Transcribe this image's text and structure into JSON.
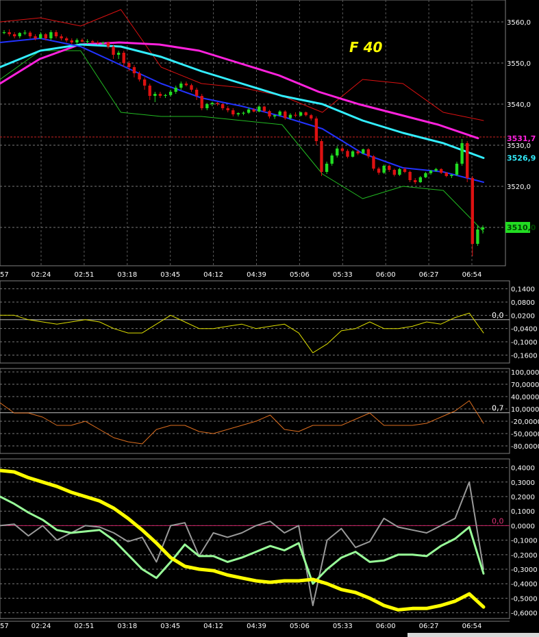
{
  "chart_data": {
    "type": "candlestick",
    "title": "F 40",
    "time_labels": [
      "02:24",
      "02:51",
      "03:18",
      "03:45",
      "04:12",
      "04:39",
      "05:06",
      "05:33",
      "06:00",
      "06:27",
      "06:54"
    ],
    "time_label_partial": "57",
    "colors": {
      "up": "#22dd22",
      "down": "#dd1111",
      "ma_magenta": "#ff22dd",
      "ma_cyan": "#33eeff",
      "ma_blue": "#2233ff",
      "band_upper": "#dd1111",
      "band_lower": "#22bb22",
      "osc1": "#e0e000",
      "osc2": "#e07020",
      "fast": "#99ff99",
      "slow": "#ffff00",
      "gray": "#9a9a9a",
      "zero_line": "#cc2266"
    },
    "price_panel": {
      "y_ticks": [
        "3560,0",
        "3550,0",
        "3540,0",
        "3530,0",
        "3520,0"
      ],
      "y_tick_values": [
        3560,
        3550,
        3540,
        3530,
        3520
      ],
      "ylim": [
        3502,
        3564
      ],
      "value_labels": [
        {
          "text": "3531,7",
          "value": 3531.7,
          "color": "#ff22dd"
        },
        {
          "text": "3526,9",
          "value": 3526.9,
          "color": "#33eeff"
        },
        {
          "text": "3510,0",
          "value": 3510.0,
          "color": "#22dd22"
        }
      ],
      "dashed_level": 3532,
      "candles": [
        [
          3557.5,
          3558,
          3557,
          3557.5
        ],
        [
          3557.5,
          3558.2,
          3556.5,
          3557
        ],
        [
          3557,
          3557.5,
          3556,
          3556.5
        ],
        [
          3556.5,
          3557.5,
          3556,
          3557.3
        ],
        [
          3557.3,
          3558,
          3556.8,
          3557.4
        ],
        [
          3557.4,
          3557.8,
          3556,
          3556.5
        ],
        [
          3556.5,
          3557,
          3555.5,
          3556
        ],
        [
          3556,
          3557.5,
          3555.8,
          3557
        ],
        [
          3557,
          3557.3,
          3555.5,
          3556
        ],
        [
          3556,
          3558,
          3555.5,
          3557.5
        ],
        [
          3557.5,
          3558,
          3556,
          3556.5
        ],
        [
          3556.5,
          3557,
          3555.5,
          3556
        ],
        [
          3556,
          3556.4,
          3555,
          3555.5
        ],
        [
          3555.5,
          3556,
          3554.5,
          3555
        ],
        [
          3555,
          3556,
          3554.5,
          3555.6
        ],
        [
          3555.6,
          3556,
          3555,
          3555.2
        ],
        [
          3555.2,
          3555.8,
          3554.6,
          3555.3
        ],
        [
          3555.3,
          3555.6,
          3554.8,
          3555
        ],
        [
          3555,
          3555.4,
          3554.5,
          3554.9
        ],
        [
          3554.9,
          3555.2,
          3554.4,
          3555
        ],
        [
          3555,
          3555.2,
          3553.5,
          3554
        ],
        [
          3554,
          3554.5,
          3551,
          3552
        ],
        [
          3552,
          3553,
          3551,
          3552.5
        ],
        [
          3552.5,
          3553,
          3549,
          3550
        ],
        [
          3550,
          3550.5,
          3548,
          3549
        ],
        [
          3549,
          3549.5,
          3546.5,
          3547.5
        ],
        [
          3547.5,
          3548,
          3545.5,
          3546
        ],
        [
          3546,
          3546.5,
          3543.5,
          3544.5
        ],
        [
          3544.5,
          3545,
          3541,
          3542
        ],
        [
          3542,
          3543,
          3540.5,
          3542.5
        ],
        [
          3542.5,
          3543,
          3541.5,
          3542
        ],
        [
          3542,
          3542.5,
          3541.5,
          3542.2
        ],
        [
          3542.2,
          3543.5,
          3541.8,
          3543
        ],
        [
          3543,
          3544.5,
          3542.5,
          3544
        ],
        [
          3544,
          3545.5,
          3543.5,
          3545
        ],
        [
          3545,
          3545.5,
          3544.3,
          3544.6
        ],
        [
          3544.6,
          3545,
          3543,
          3543.5
        ],
        [
          3543.5,
          3544,
          3541,
          3542
        ],
        [
          3542,
          3542.5,
          3538.5,
          3539
        ],
        [
          3539,
          3540.3,
          3538.5,
          3540
        ],
        [
          3540,
          3540.6,
          3539.5,
          3540.3
        ],
        [
          3540.3,
          3540.5,
          3539.6,
          3540
        ],
        [
          3540,
          3540.2,
          3538.5,
          3539
        ],
        [
          3539,
          3539.5,
          3538,
          3538.5
        ],
        [
          3538.5,
          3539,
          3537,
          3537.5
        ],
        [
          3537.5,
          3538,
          3537,
          3537.8
        ],
        [
          3537.8,
          3538.2,
          3537.3,
          3537.9
        ],
        [
          3537.9,
          3539.2,
          3537.6,
          3538.7
        ],
        [
          3538.7,
          3539,
          3538,
          3538.2
        ],
        [
          3538.2,
          3539.7,
          3538,
          3539.4
        ],
        [
          3539.4,
          3539.6,
          3538,
          3538.3
        ],
        [
          3538.3,
          3538.6,
          3536.5,
          3537
        ],
        [
          3537,
          3537.5,
          3536.4,
          3537.3
        ],
        [
          3537.3,
          3538.5,
          3537,
          3538.2
        ],
        [
          3538.2,
          3538.5,
          3536.2,
          3536.6
        ],
        [
          3536.6,
          3537.8,
          3536.2,
          3537.4
        ],
        [
          3537.4,
          3538,
          3536.8,
          3537.2
        ],
        [
          3537.2,
          3538.2,
          3537,
          3538
        ],
        [
          3538,
          3538.2,
          3537,
          3537.3
        ],
        [
          3537.3,
          3537.6,
          3536,
          3536.5
        ],
        [
          3536.5,
          3537,
          3530,
          3531
        ],
        [
          3531,
          3531.5,
          3522.5,
          3523.5
        ],
        [
          3523.5,
          3526,
          3523,
          3525.5
        ],
        [
          3525.5,
          3528,
          3525,
          3527.5
        ],
        [
          3527.5,
          3529.8,
          3527,
          3529.2
        ],
        [
          3529.2,
          3529.8,
          3528.3,
          3528.6
        ],
        [
          3528.6,
          3529,
          3526.8,
          3527.2
        ],
        [
          3527.2,
          3528.8,
          3527,
          3528.5
        ],
        [
          3528.5,
          3528.9,
          3527.6,
          3528
        ],
        [
          3528,
          3529.2,
          3527.8,
          3529
        ],
        [
          3529,
          3529.3,
          3526.8,
          3527.3
        ],
        [
          3527.3,
          3527.6,
          3523.8,
          3524.3
        ],
        [
          3524.3,
          3524.7,
          3522.8,
          3523.3
        ],
        [
          3523.3,
          3525.3,
          3523,
          3525
        ],
        [
          3525,
          3525.3,
          3523.5,
          3524
        ],
        [
          3524,
          3524.3,
          3522.4,
          3522.8
        ],
        [
          3522.8,
          3524.5,
          3522.5,
          3524.2
        ],
        [
          3524.2,
          3524.6,
          3523.2,
          3523.5
        ],
        [
          3523.5,
          3523.8,
          3521,
          3521.5
        ],
        [
          3521.5,
          3522,
          3520.5,
          3521
        ],
        [
          3521,
          3522.5,
          3520.8,
          3522.2
        ],
        [
          3522.2,
          3523.5,
          3522,
          3523.2
        ],
        [
          3523.2,
          3524,
          3522.8,
          3523.8
        ],
        [
          3523.8,
          3524.5,
          3523.5,
          3524.2
        ],
        [
          3524.2,
          3524.4,
          3523,
          3523.3
        ],
        [
          3523.3,
          3523.5,
          3522.2,
          3522.5
        ],
        [
          3522.5,
          3523,
          3522,
          3522.8
        ],
        [
          3522.8,
          3526,
          3522.5,
          3525.5
        ],
        [
          3525.5,
          3531.5,
          3525,
          3530.5
        ],
        [
          3530.5,
          3531,
          3521,
          3522
        ],
        [
          3522,
          3522.5,
          3503,
          3506
        ],
        [
          3506,
          3510.5,
          3505.5,
          3509.5
        ],
        [
          3509.5,
          3510.5,
          3508.5,
          3510
        ]
      ],
      "ma_magenta": [
        3545,
        3551,
        3554.5,
        3555,
        3554.5,
        3553,
        3550,
        3547,
        3543,
        3540,
        3537.5,
        3535,
        3531.7
      ],
      "ma_cyan": [
        3549,
        3553,
        3554.5,
        3554,
        3551.5,
        3548,
        3545,
        3542,
        3540,
        3536,
        3533,
        3530.5,
        3526.9
      ],
      "ma_blue": [
        3555,
        3556,
        3554,
        3549.5,
        3545,
        3541.5,
        3539.5,
        3537,
        3534,
        3528,
        3524.5,
        3523.5,
        3521
      ],
      "band_upper": [
        3560,
        3561,
        3559,
        3563,
        3549,
        3545,
        3544,
        3542,
        3538,
        3546,
        3545,
        3538,
        3536
      ],
      "band_lower": [
        3546,
        3553,
        3553,
        3538,
        3537,
        3537,
        3536,
        3535,
        3523,
        3517,
        3520,
        3519,
        3509
      ]
    },
    "osc1_panel": {
      "y_ticks": [
        "0,1400",
        "0,0800",
        "0,0200",
        "-0,0400",
        "-0,1000",
        "-0,1600"
      ],
      "y_tick_values": [
        0.14,
        0.08,
        0.02,
        -0.04,
        -0.1,
        -0.16
      ],
      "ylim": [
        -0.19,
        0.17
      ],
      "zero_label": "0,0",
      "values": [
        0.02,
        0.02,
        0.0,
        -0.01,
        -0.02,
        -0.01,
        0.0,
        -0.01,
        -0.04,
        -0.06,
        -0.06,
        -0.02,
        0.02,
        -0.01,
        -0.04,
        -0.04,
        -0.03,
        -0.02,
        -0.04,
        -0.03,
        -0.02,
        -0.06,
        -0.15,
        -0.11,
        -0.05,
        -0.04,
        -0.01,
        -0.04,
        -0.04,
        -0.03,
        -0.01,
        -0.02,
        0.01,
        0.03,
        -0.06
      ]
    },
    "osc2_panel": {
      "y_ticks": [
        "100,0000",
        "70,0000",
        "40,0000",
        "10,0000",
        "-20,0000",
        "-50,0000",
        "-80,0000"
      ],
      "y_tick_values": [
        100,
        70,
        40,
        10,
        -20,
        -50,
        -80
      ],
      "ylim": [
        -95,
        105
      ],
      "zero_label": "0,7",
      "values": [
        25,
        0,
        0,
        -10,
        -30,
        -30,
        -20,
        -40,
        -60,
        -70,
        -75,
        -40,
        -30,
        -30,
        -45,
        -50,
        -40,
        -30,
        -20,
        -5,
        -40,
        -45,
        -30,
        -30,
        -30,
        -15,
        0,
        -30,
        -30,
        -30,
        -25,
        -10,
        5,
        30,
        -25
      ]
    },
    "osc3_panel": {
      "y_ticks": [
        "0,4000",
        "0,3000",
        "0,2000",
        "0,1000",
        "0,0000",
        "-0,1000",
        "-0,2000",
        "-0,3000",
        "-0,4000",
        "-0,5000",
        "-0,6000"
      ],
      "y_tick_values": [
        0.4,
        0.3,
        0.2,
        0.1,
        0.0,
        -0.1,
        -0.2,
        -0.3,
        -0.4,
        -0.5,
        -0.6
      ],
      "ylim": [
        -0.63,
        0.45
      ],
      "zero_label": "0,0",
      "slow_values": [
        0.38,
        0.37,
        0.33,
        0.3,
        0.27,
        0.23,
        0.2,
        0.17,
        0.12,
        0.05,
        -0.03,
        -0.12,
        -0.22,
        -0.28,
        -0.3,
        -0.31,
        -0.34,
        -0.36,
        -0.38,
        -0.39,
        -0.38,
        -0.38,
        -0.37,
        -0.4,
        -0.44,
        -0.46,
        -0.5,
        -0.55,
        -0.58,
        -0.57,
        -0.57,
        -0.55,
        -0.52,
        -0.47,
        -0.56
      ],
      "fast_values": [
        0.2,
        0.15,
        0.09,
        0.04,
        -0.03,
        -0.05,
        -0.04,
        -0.03,
        -0.1,
        -0.2,
        -0.3,
        -0.36,
        -0.25,
        -0.13,
        -0.21,
        -0.21,
        -0.25,
        -0.22,
        -0.18,
        -0.14,
        -0.17,
        -0.12,
        -0.4,
        -0.3,
        -0.22,
        -0.18,
        -0.25,
        -0.24,
        -0.2,
        -0.2,
        -0.21,
        -0.14,
        -0.09,
        -0.01,
        -0.33
      ],
      "gray_values": [
        0.0,
        0.01,
        -0.07,
        0.0,
        -0.1,
        -0.05,
        0.0,
        -0.01,
        -0.05,
        -0.11,
        -0.08,
        -0.25,
        0.0,
        0.02,
        -0.21,
        -0.05,
        -0.08,
        -0.05,
        0.0,
        0.03,
        -0.05,
        0.0,
        -0.55,
        -0.1,
        -0.02,
        -0.15,
        -0.11,
        0.05,
        -0.01,
        -0.03,
        -0.05,
        0.0,
        0.05,
        0.3,
        -0.3
      ]
    }
  }
}
